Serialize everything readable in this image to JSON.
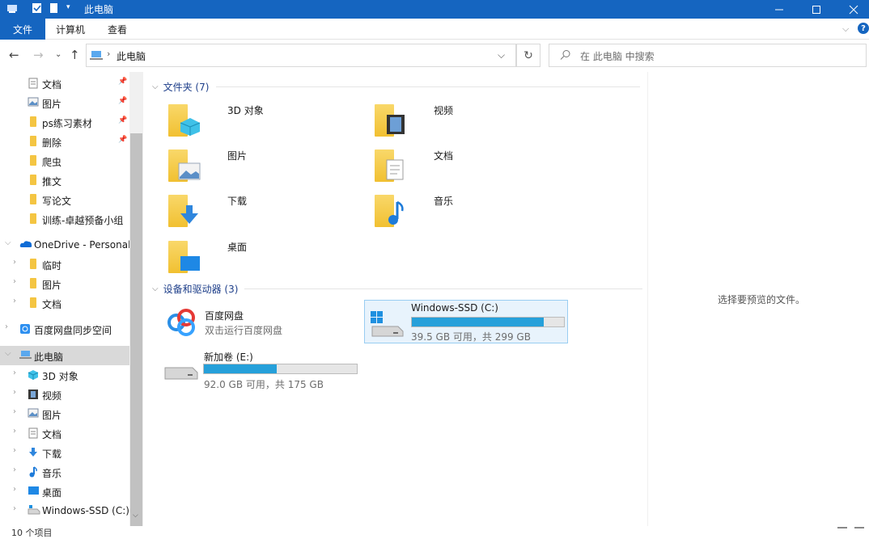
{
  "window": {
    "title": "此电脑"
  },
  "ribbon": {
    "tabs": [
      "文件",
      "计算机",
      "查看"
    ]
  },
  "address": {
    "crumb": "此电脑"
  },
  "search": {
    "placeholder": "在 此电脑 中搜索"
  },
  "sidebar": {
    "items": [
      {
        "label": "文档",
        "icon": "document-icon"
      },
      {
        "label": "图片",
        "icon": "pictures-icon"
      },
      {
        "label": "ps练习素材",
        "icon": "folder-icon"
      },
      {
        "label": "删除",
        "icon": "folder-icon"
      },
      {
        "label": "爬虫",
        "icon": "folder-icon"
      },
      {
        "label": "推文",
        "icon": "folder-icon"
      },
      {
        "label": "写论文",
        "icon": "folder-icon"
      },
      {
        "label": "训练-卓越预备小组",
        "icon": "folder-icon"
      },
      {
        "label": "OneDrive - Personal",
        "icon": "onedrive-icon"
      },
      {
        "label": "临时",
        "icon": "folder-icon"
      },
      {
        "label": "图片",
        "icon": "folder-icon"
      },
      {
        "label": "文档",
        "icon": "folder-icon"
      },
      {
        "label": "百度网盘同步空间",
        "icon": "baidu-sync-icon"
      },
      {
        "label": "此电脑",
        "icon": "this-pc-icon"
      },
      {
        "label": "3D 对象",
        "icon": "3d-objects-icon"
      },
      {
        "label": "视频",
        "icon": "videos-icon"
      },
      {
        "label": "图片",
        "icon": "pictures-icon"
      },
      {
        "label": "文档",
        "icon": "document-icon"
      },
      {
        "label": "下载",
        "icon": "download-icon"
      },
      {
        "label": "音乐",
        "icon": "music-icon"
      },
      {
        "label": "桌面",
        "icon": "desktop-icon"
      },
      {
        "label": "Windows-SSD (C:)",
        "icon": "drive-icon"
      }
    ]
  },
  "main": {
    "folders_header": "文件夹 (7)",
    "folders": [
      {
        "label": "3D 对象"
      },
      {
        "label": "视频"
      },
      {
        "label": "图片"
      },
      {
        "label": "文档"
      },
      {
        "label": "下载"
      },
      {
        "label": "音乐"
      },
      {
        "label": "桌面"
      }
    ],
    "devices_header": "设备和驱动器 (3)",
    "devices": {
      "baidu": {
        "name": "百度网盘",
        "sub": "双击运行百度网盘"
      },
      "c_drive": {
        "name": "Windows-SSD (C:)",
        "sub": "39.5 GB 可用，共 299 GB",
        "used_fraction": 0.868
      },
      "e_drive": {
        "name": "新加卷 (E:)",
        "sub": "92.0 GB 可用，共 175 GB",
        "used_fraction": 0.474
      }
    }
  },
  "preview": {
    "text": "选择要预览的文件。"
  },
  "status": {
    "count": "10 个项目"
  },
  "colors": {
    "accent": "#1565c0",
    "bar_fill": "#26a0da",
    "folder": "#f4c542"
  }
}
